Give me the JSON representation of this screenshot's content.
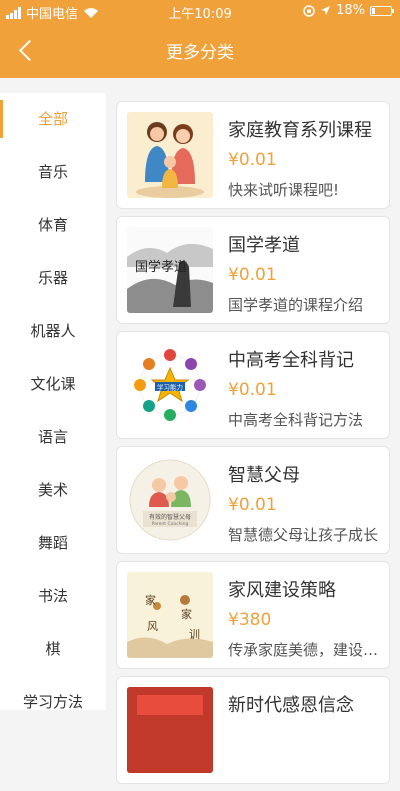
{
  "status_bar": {
    "carrier": "中国电信",
    "time": "上午10:09",
    "battery": "18%"
  },
  "header": {
    "title": "更多分类"
  },
  "sidebar": {
    "items": [
      {
        "label": "全部",
        "active": true
      },
      {
        "label": "音乐"
      },
      {
        "label": "体育"
      },
      {
        "label": "乐器"
      },
      {
        "label": "机器人"
      },
      {
        "label": "文化课"
      },
      {
        "label": "语言"
      },
      {
        "label": "美术"
      },
      {
        "label": "舞蹈"
      },
      {
        "label": "书法"
      },
      {
        "label": "棋"
      },
      {
        "label": "学习方法"
      }
    ]
  },
  "courses": [
    {
      "title": "家庭教育系列课程",
      "price": "¥0.01",
      "desc": "快来试听课程吧!"
    },
    {
      "title": "国学孝道",
      "price": "¥0.01",
      "desc": "国学孝道的课程介绍"
    },
    {
      "title": "中高考全科背记",
      "price": "¥0.01",
      "desc": "中高考全科背记方法"
    },
    {
      "title": "智慧父母",
      "price": "¥0.01",
      "desc": "智慧德父母让孩子成长"
    },
    {
      "title": "家风建设策略",
      "price": "¥380",
      "desc": "传承家庭美德，建设好家风"
    },
    {
      "title": "新时代感恩信念",
      "price": "",
      "desc": ""
    }
  ],
  "thumbs": {
    "c2_text": "国学孝道",
    "c3_text": "学习能力",
    "c4_text": "有效的智慧父母",
    "c4_sub": "Parent Coaching",
    "c5_text1": "家",
    "c5_text2": "风",
    "c5_text3": "家",
    "c5_text4": "训"
  },
  "colors": {
    "accent": "#f0a13a"
  }
}
